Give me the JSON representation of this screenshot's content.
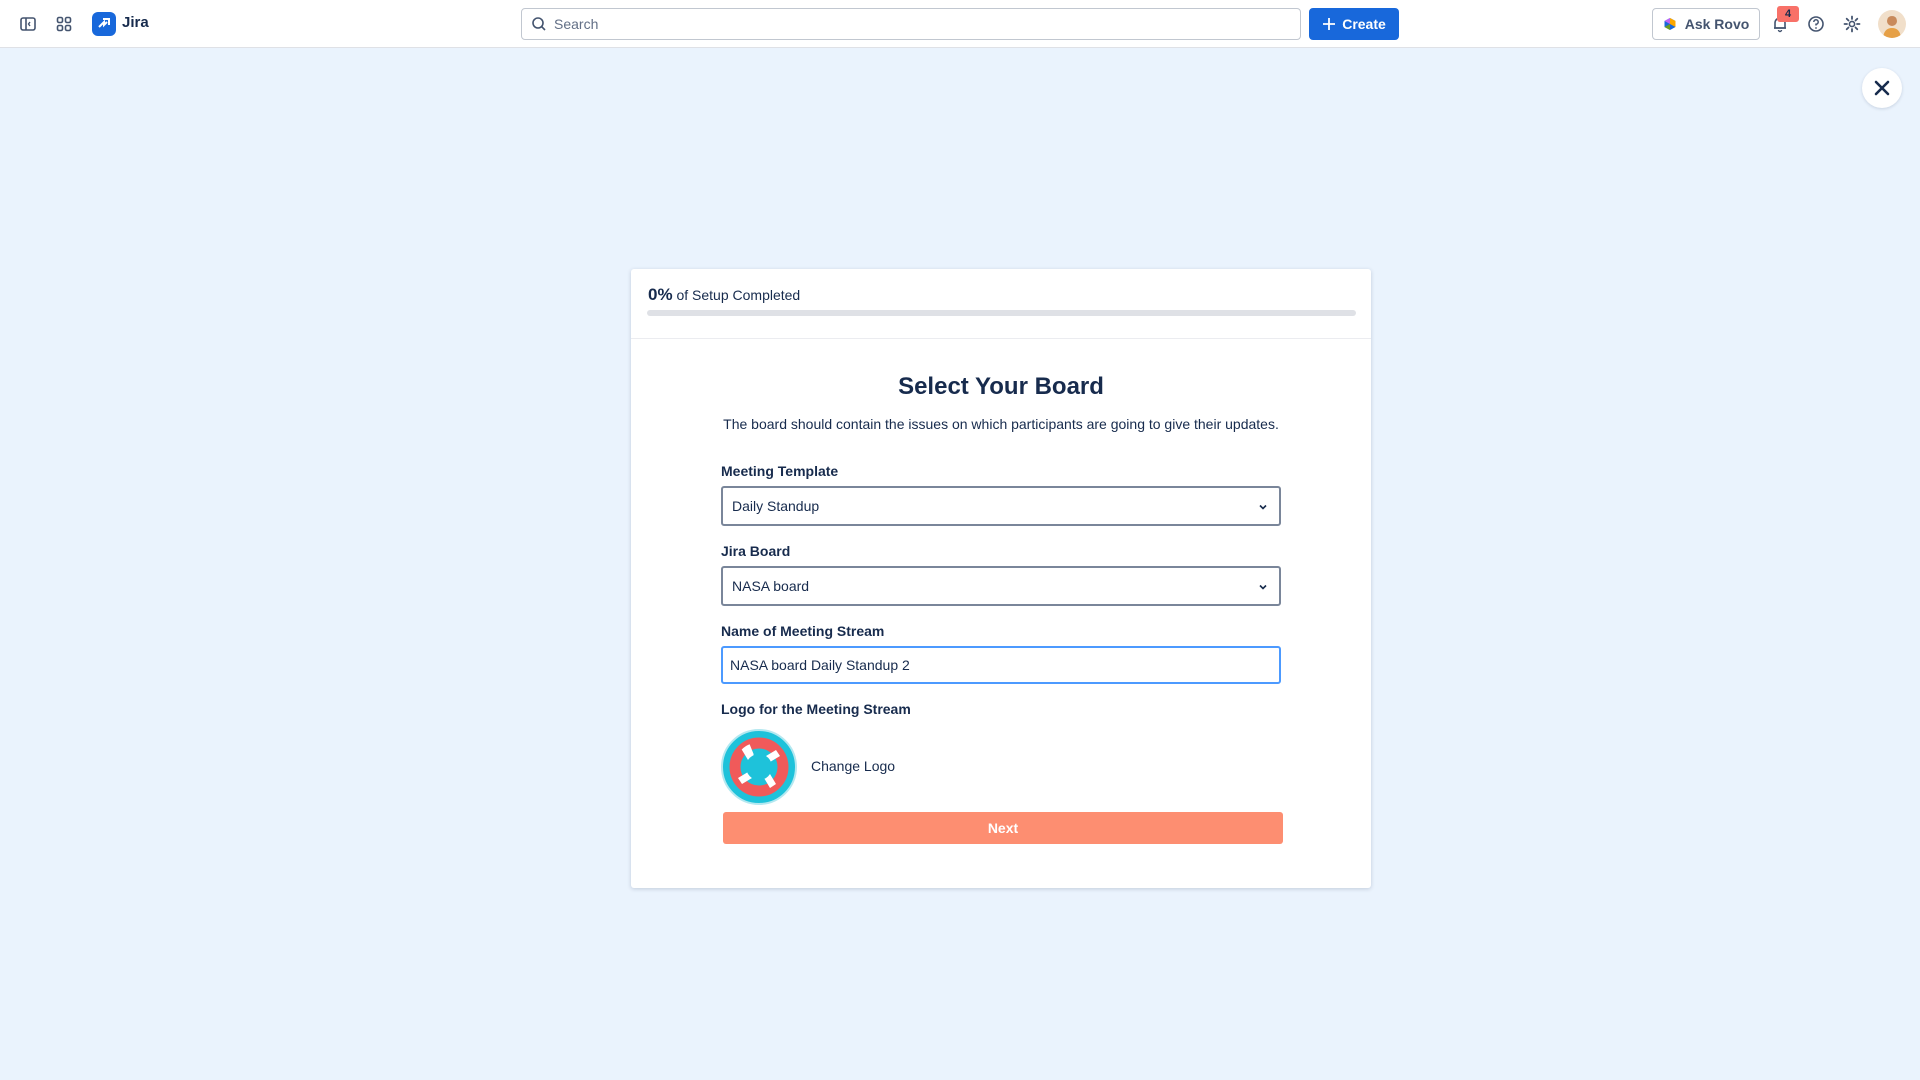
{
  "app": {
    "name": "Jira"
  },
  "search": {
    "placeholder": "Search"
  },
  "topbar": {
    "create_label": "Create",
    "rovo_label": "Ask Rovo",
    "notification_count": "4"
  },
  "setup": {
    "progress_value": "0%",
    "progress_suffix": "of Setup Completed",
    "progress_fraction": 0,
    "title": "Select Your Board",
    "subtitle": "The board should contain the issues on which participants are going to give their updates.",
    "meeting_template": {
      "label": "Meeting Template",
      "value": "Daily Standup"
    },
    "jira_board": {
      "label": "Jira Board",
      "value": "NASA board"
    },
    "stream_name": {
      "label": "Name of Meeting Stream",
      "value": "NASA board Daily Standup 2"
    },
    "logo": {
      "label": "Logo for the Meeting Stream",
      "change_label": "Change Logo",
      "icon": "lifebuoy-icon"
    },
    "next_label": "Next"
  },
  "colors": {
    "brand": "#1868db",
    "background": "#eaf3fd",
    "next_button": "#fd8e71",
    "badge": "#f87168"
  }
}
